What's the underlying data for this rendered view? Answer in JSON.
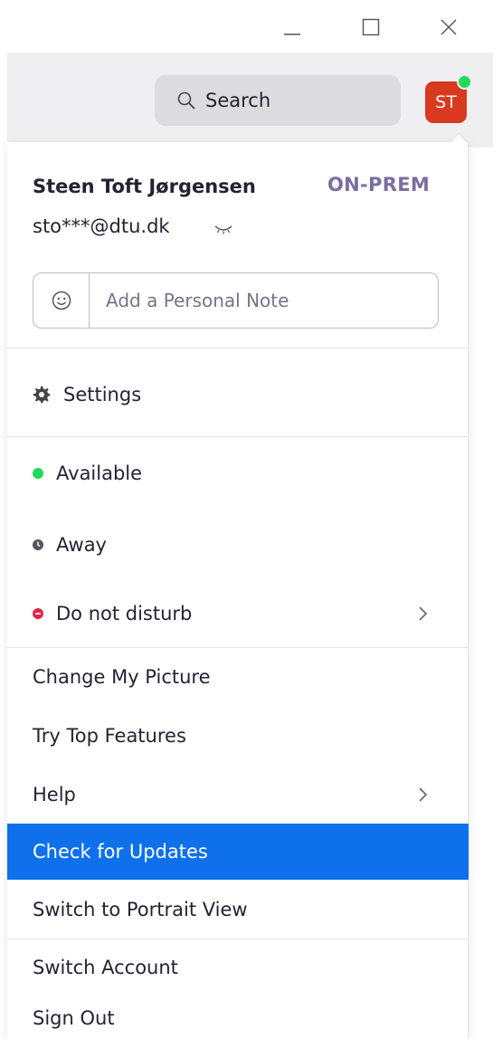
{
  "window": {
    "controls": [
      "minimize-icon",
      "maximize-icon",
      "close-icon"
    ]
  },
  "toolbar": {
    "search_label": "Search",
    "avatar_initials": "ST",
    "avatar_color": "#d9391f",
    "presence_dot_color": "#23d959"
  },
  "profile": {
    "name": "Steen Toft Jørgensen",
    "badge": "ON-PREM",
    "email": "sto***@dtu.dk",
    "email_visibility_icon": "eye-closed-icon",
    "note_placeholder": "Add a Personal Note",
    "note_icon": "smiley-icon"
  },
  "menu": {
    "settings": "Settings",
    "status": {
      "available": "Available",
      "available_color": "#23d959",
      "away": "Away",
      "away_color": "#555560",
      "dnd": "Do not disturb",
      "dnd_color": "#e0264a"
    },
    "items": [
      "Change My Picture",
      "Try Top Features",
      "Help",
      "Check for Updates",
      "Switch to Portrait View",
      "Switch Account",
      "Sign Out"
    ],
    "selected_item": "Check for Updates",
    "accent_color": "#0e71eb"
  }
}
